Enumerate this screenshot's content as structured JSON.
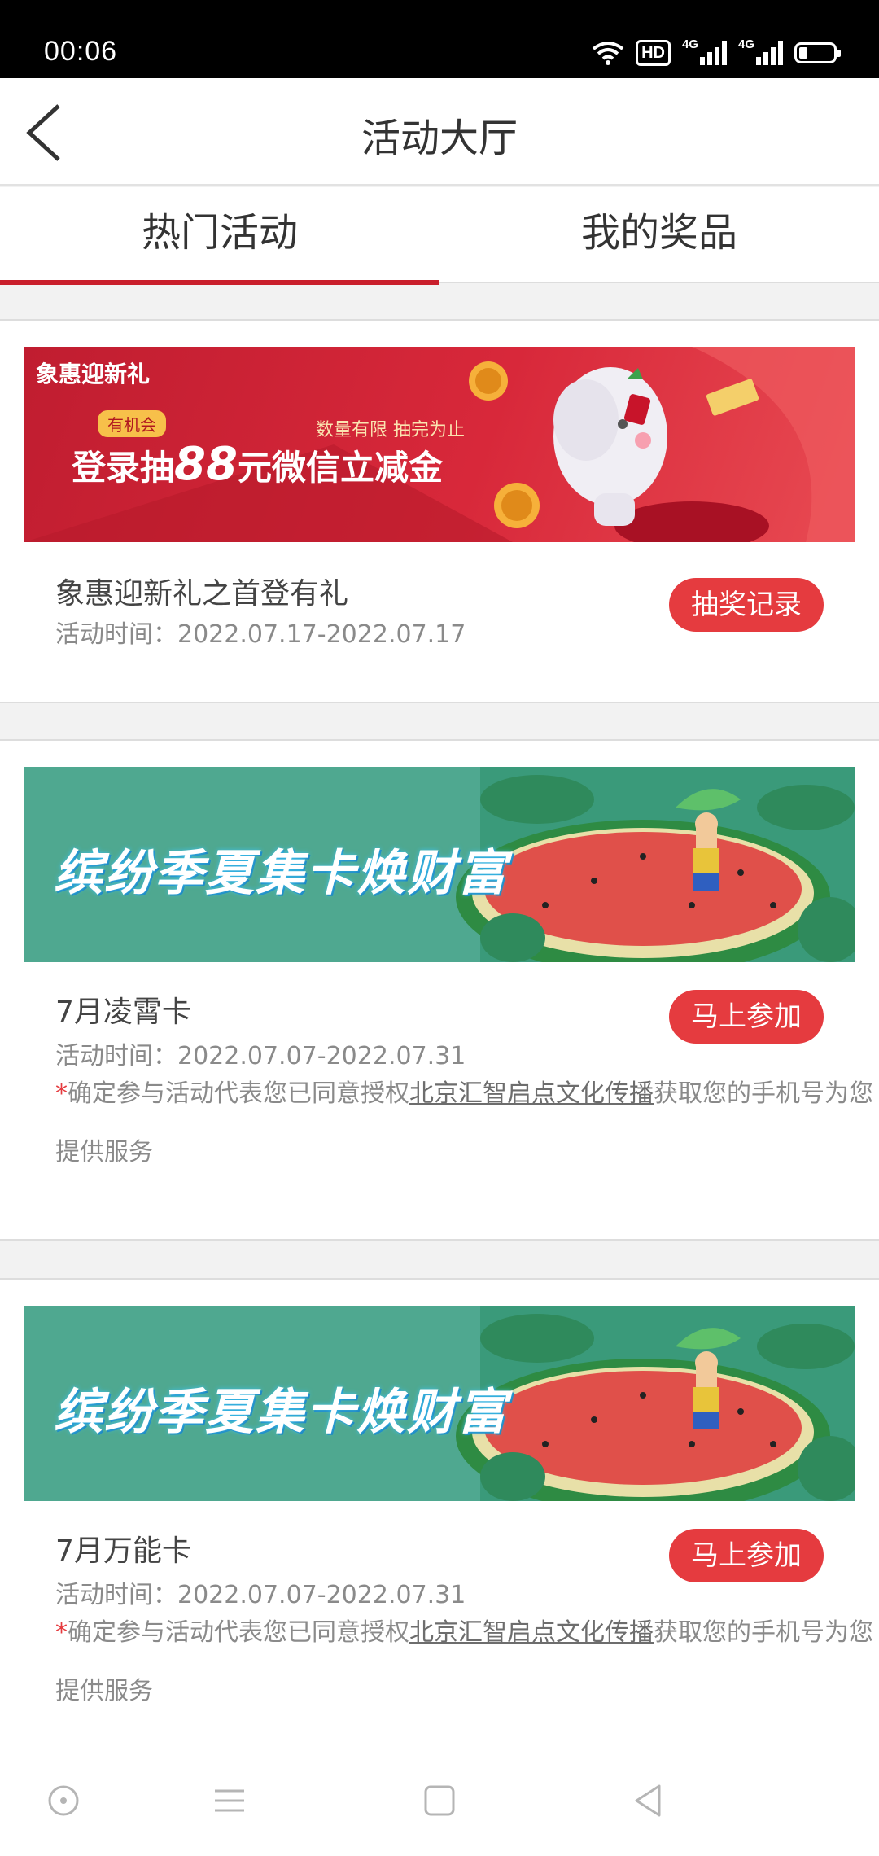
{
  "status_bar": {
    "time": "00:06",
    "hd_label": "HD",
    "signal1_label": "4G",
    "signal2_label": "4G"
  },
  "header": {
    "title": "活动大厅"
  },
  "tabs": [
    {
      "label": "热门活动",
      "active": true
    },
    {
      "label": "我的奖品",
      "active": false
    }
  ],
  "activities": [
    {
      "banner": {
        "logo": "象惠迎新礼",
        "badge": "有机会",
        "tagline": "数量有限 抽完为止",
        "headline_pre": "登录抽",
        "headline_num": "88",
        "headline_post": "元微信立减金"
      },
      "name": "象惠迎新礼之首登有礼",
      "time": "活动时间：2022.07.17-2022.07.17",
      "button": "抽奖记录"
    },
    {
      "banner": {
        "headline": "缤纷季夏集卡焕财富"
      },
      "name": "7月凌霄卡",
      "time": "活动时间：2022.07.07-2022.07.31",
      "button": "马上参加",
      "notice": {
        "star": "*",
        "prefix": "确定参与活动代表您已同意授权",
        "link": "北京汇智启点文化传播",
        "suffix": "获取您的手机号为您提供服务"
      }
    },
    {
      "banner": {
        "headline": "缤纷季夏集卡焕财富"
      },
      "name": "7月万能卡",
      "time": "活动时间：2022.07.07-2022.07.31",
      "button": "马上参加",
      "notice": {
        "star": "*",
        "prefix": "确定参与活动代表您已同意授权",
        "link": "北京汇智启点文化传播",
        "suffix": "获取您的手机号为您提供服务"
      }
    }
  ],
  "colors": {
    "accent": "#e53b3f",
    "tab_underline": "#c91f2c",
    "banner_red": "#d4283a",
    "banner_green": "#4fa890"
  },
  "nav_icons": [
    "home-circle-icon",
    "menu-icon",
    "square-icon",
    "back-triangle-icon"
  ]
}
